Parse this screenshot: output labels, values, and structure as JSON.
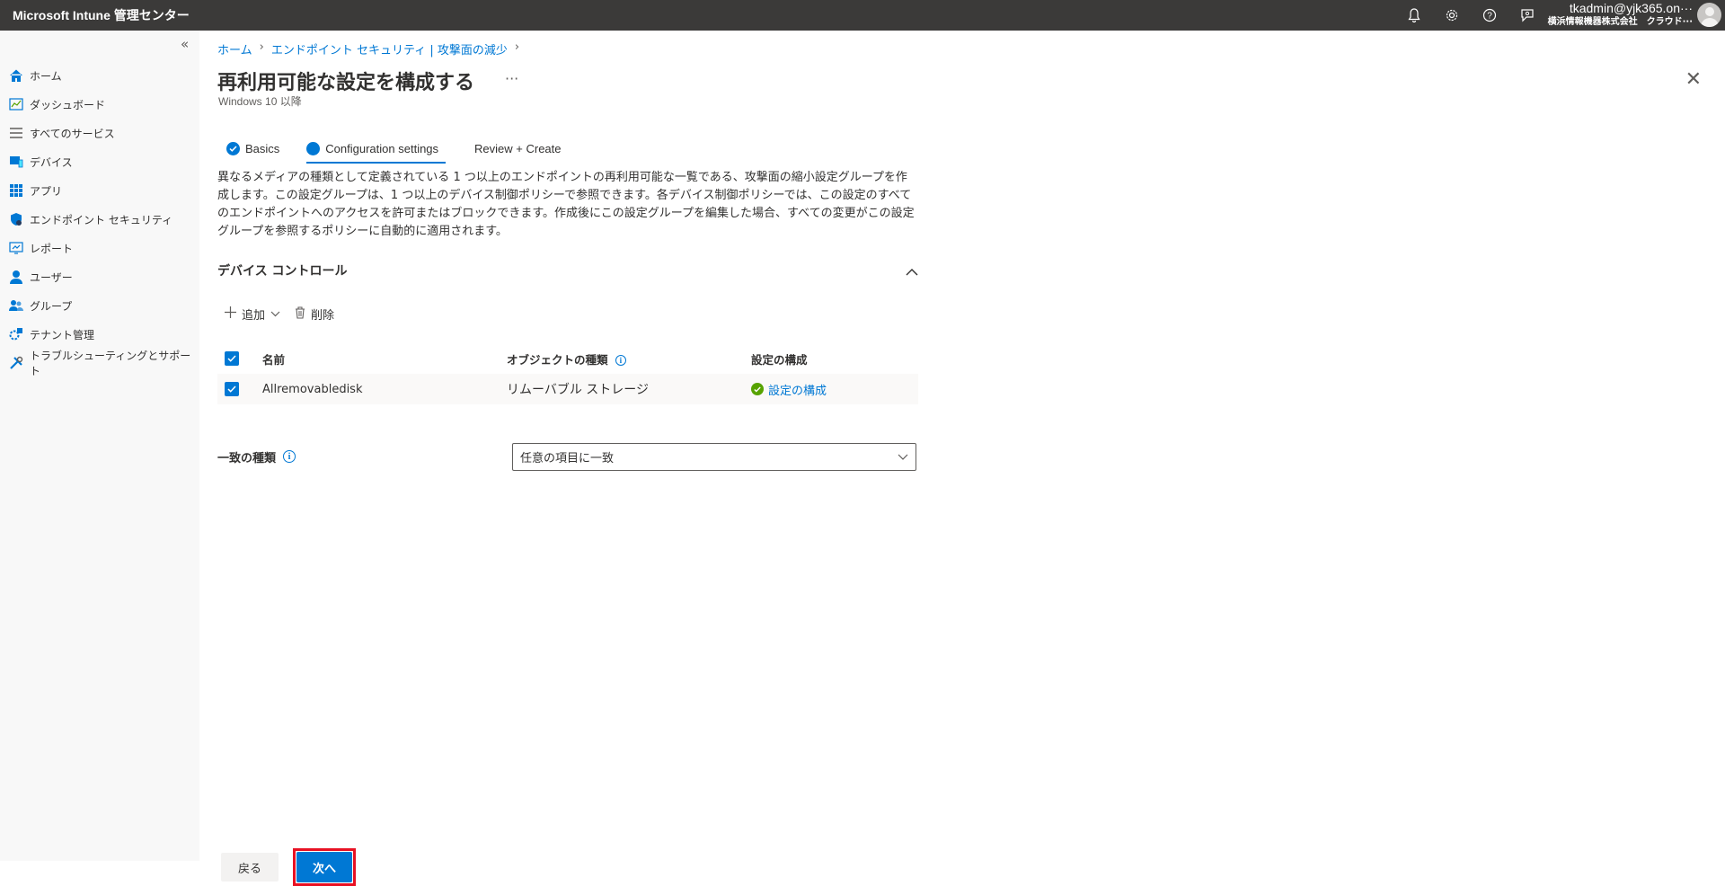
{
  "topbar": {
    "title": "Microsoft Intune 管理センター",
    "account_email": "tkadmin@yjk365.on···",
    "account_org": "横浜情報機器株式会社　クラウド···",
    "icons": [
      "bell-icon",
      "gear-icon",
      "help-icon",
      "feedback-icon"
    ]
  },
  "sidebar": {
    "collapse": "«",
    "items": [
      {
        "label": "ホーム",
        "icon": "home-icon"
      },
      {
        "label": "ダッシュボード",
        "icon": "dashboard-icon"
      },
      {
        "label": "すべてのサービス",
        "icon": "list-icon"
      },
      {
        "label": "デバイス",
        "icon": "devices-icon"
      },
      {
        "label": "アプリ",
        "icon": "apps-icon"
      },
      {
        "label": "エンドポイント セキュリティ",
        "icon": "shield-icon"
      },
      {
        "label": "レポート",
        "icon": "reports-icon"
      },
      {
        "label": "ユーザー",
        "icon": "user-icon"
      },
      {
        "label": "グループ",
        "icon": "group-icon"
      },
      {
        "label": "テナント管理",
        "icon": "tenant-icon"
      },
      {
        "label": "トラブルシューティングとサポート",
        "icon": "wrench-icon"
      }
    ]
  },
  "breadcrumb": [
    "ホーム",
    "エンドポイント セキュリティ | 攻撃面の減少"
  ],
  "page": {
    "title": "再利用可能な設定を構成する",
    "more": "···",
    "subtitle": "Windows 10 以降",
    "close": "✕"
  },
  "tabs": [
    {
      "label": "Basics",
      "state": "done"
    },
    {
      "label": "Configuration settings",
      "state": "active"
    },
    {
      "label": "Review + Create",
      "state": "pending"
    }
  ],
  "description": "異なるメディアの種類として定義されている 1 つ以上のエンドポイントの再利用可能な一覧である、攻撃面の縮小設定グループを作成します。この設定グループは、1 つ以上のデバイス制御ポリシーで参照できます。各デバイス制御ポリシーでは、この設定のすべてのエンドポイントへのアクセスを許可またはブロックできます。作成後にこの設定グループを編集した場合、すべての変更がこの設定グループを参照するポリシーに自動的に適用されます。",
  "section": {
    "title": "デバイス コントロール",
    "toolbar": {
      "add": "追加",
      "delete": "削除"
    },
    "table": {
      "headers": {
        "name": "名前",
        "type": "オブジェクトの種類",
        "config": "設定の構成"
      },
      "rows": [
        {
          "name": "Allremovabledisk",
          "type": "リムーバブル ストレージ",
          "config": "設定の構成",
          "checked": true
        }
      ]
    },
    "match": {
      "label": "一致の種類",
      "value": "任意の項目に一致"
    }
  },
  "footer": {
    "back": "戻る",
    "next": "次へ"
  },
  "colors": {
    "accent": "#0078d4",
    "topbar": "#3b3a39",
    "success": "#57a300",
    "highlight": "#e81123"
  }
}
